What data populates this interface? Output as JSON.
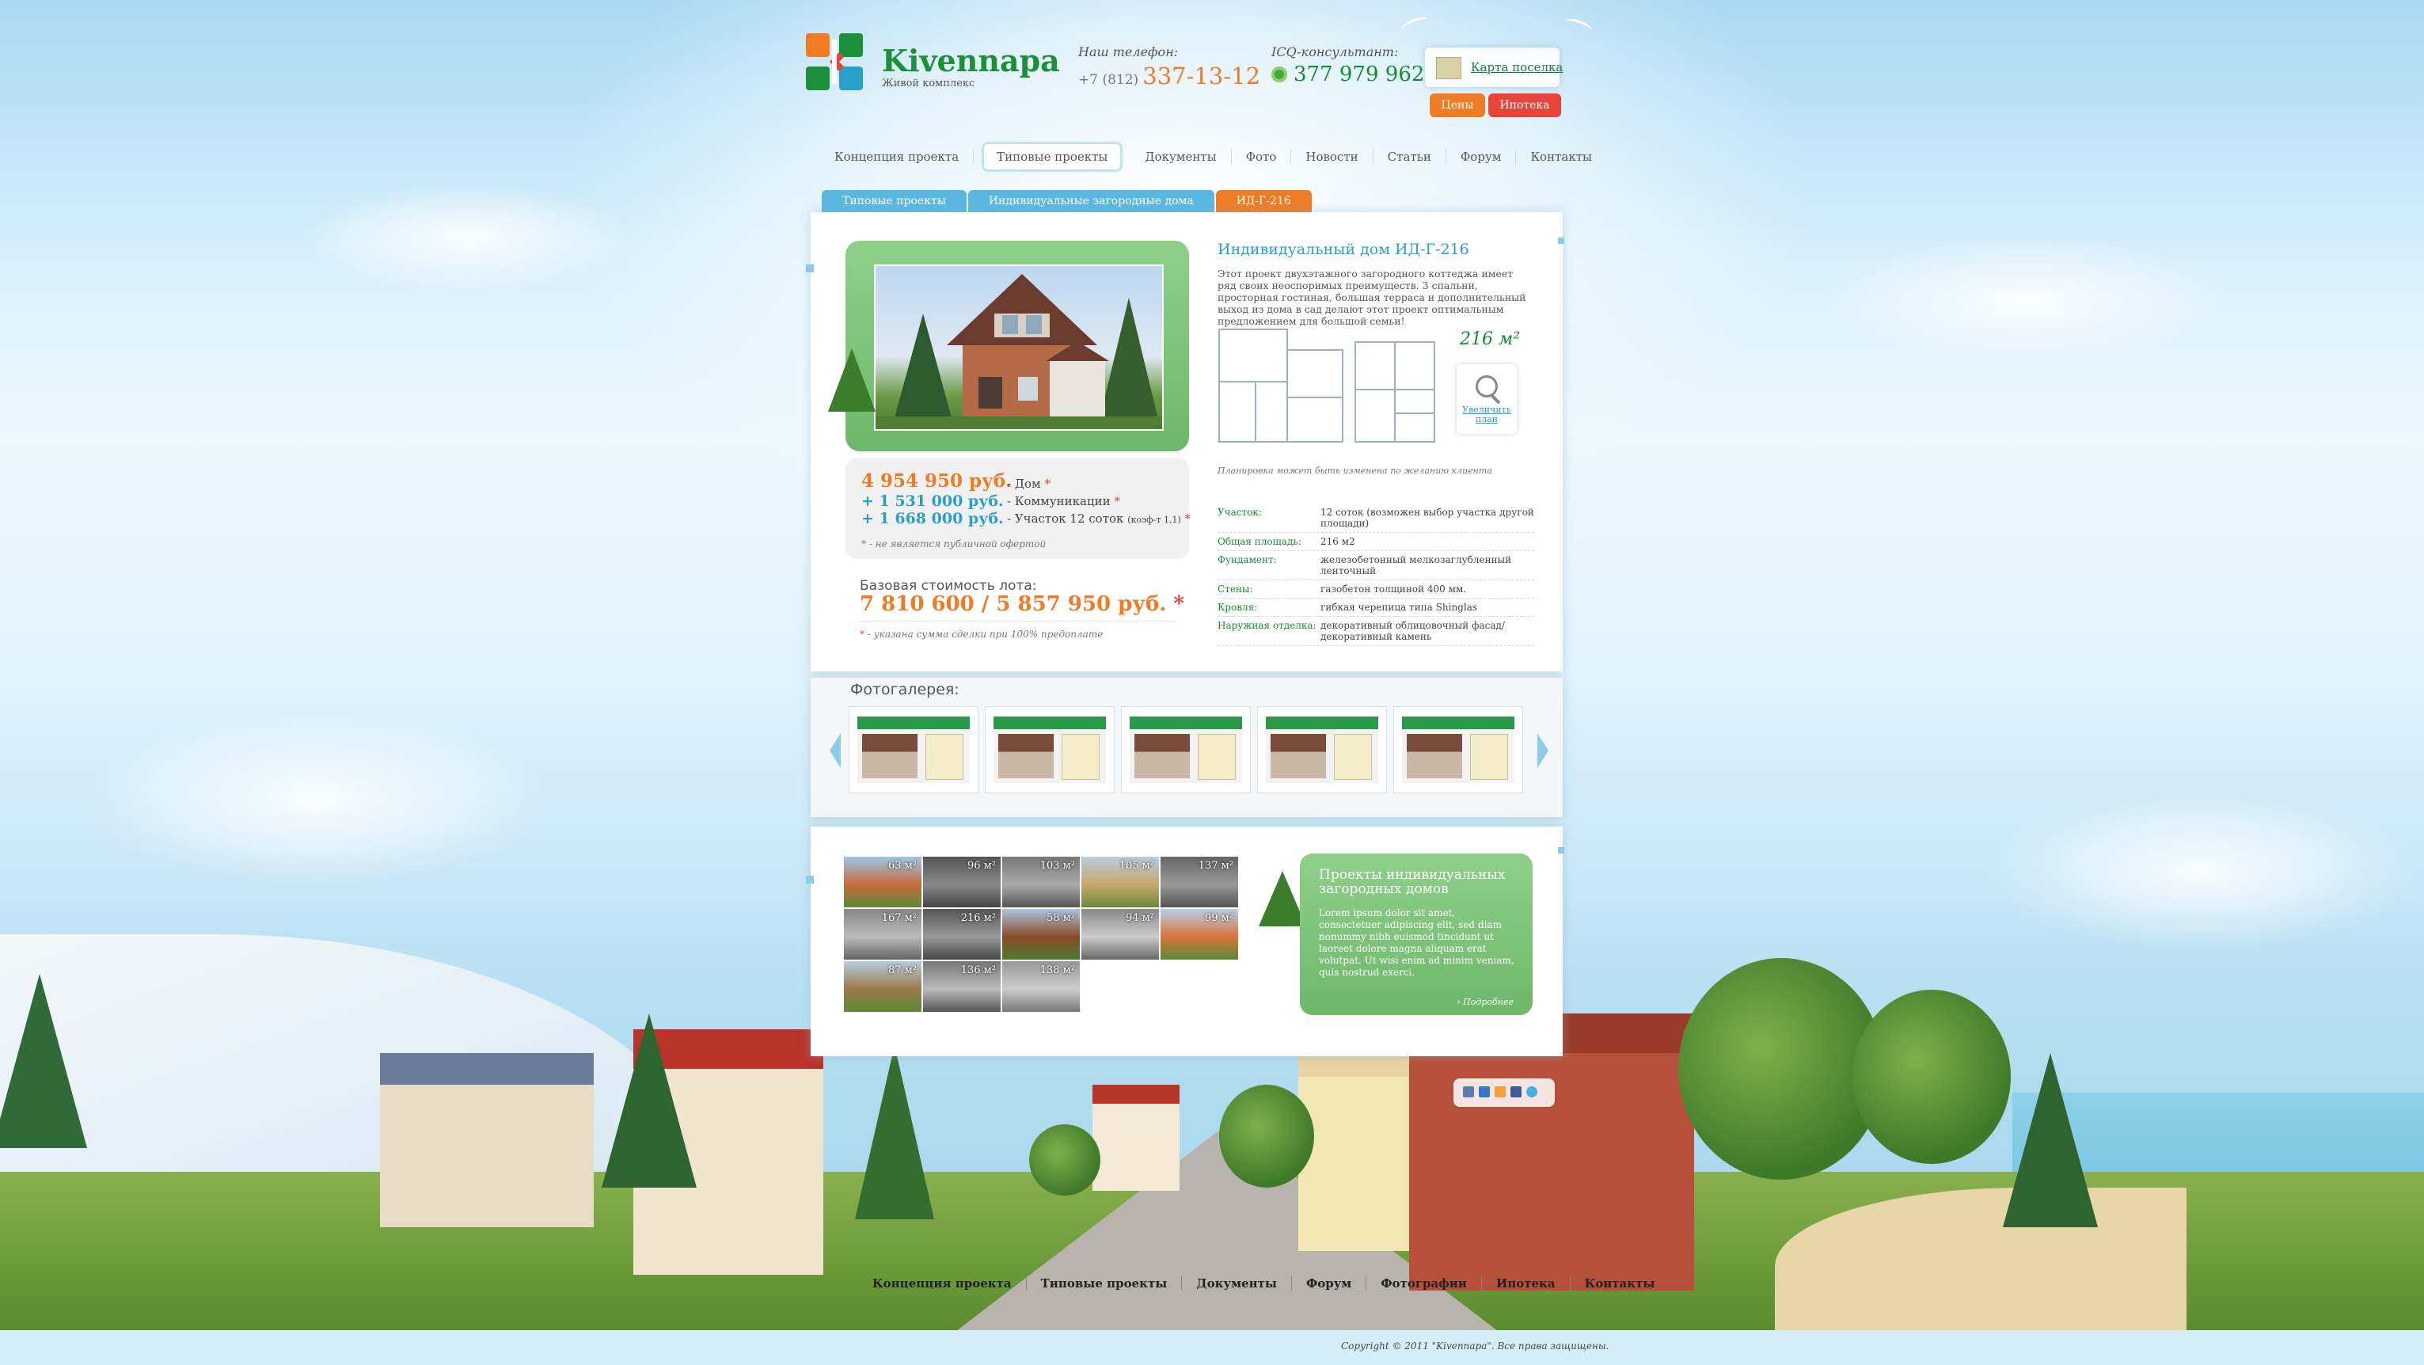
{
  "brand": {
    "name": "Kivennapa",
    "tagline": "Живой комплекс"
  },
  "header": {
    "phone_label": "Наш телефон:",
    "phone_code": "+7 (812)",
    "phone_number": "337-13-12",
    "icq_label": "ICQ-консультант:",
    "icq_number": "377 979 962",
    "map_link": "Карта поселка",
    "prices_button": "Цены",
    "mortgage_button": "Ипотека"
  },
  "nav": {
    "items": [
      "Концепция проекта",
      "Типовые проекты",
      "Документы",
      "Фото",
      "Новости",
      "Статьи",
      "Форум",
      "Контакты"
    ],
    "active_index": 1
  },
  "subtabs": [
    "Типовые проекты",
    "Индивидуальные загородные дома",
    "ИД-Г-216"
  ],
  "house": {
    "title": "Индивидуальный дом ИД-Г-216",
    "description": "Этот проект двухэтажного загородного коттеджа имеет ряд своих неоспоримых преимуществ. 3 спальни, просторная гостиная, большая терраса и дополнительный выход из дома в сад делают этот проект оптимальным предложением для большой семьи!",
    "area": "216 м²",
    "zoom_label": "Увеличить план",
    "plan_note": "Планировка может быть изменена по желанию клиента"
  },
  "prices": {
    "house_price": "4 954 950 руб.",
    "house_label": "- Дом",
    "comm_price": "+ 1 531 000 руб.",
    "comm_label": "- Коммуникации",
    "plot_price": "+ 1 668 000 руб.",
    "plot_label": "- Участок 12 соток",
    "plot_coef": "(коэф-т 1,1)",
    "offer_note": "- не является публичной офертой",
    "base_label": "Базовая стоимость лота:",
    "base_price": "7 810 600 / 5 857 950 руб.",
    "base_note": "- указана сумма сделки при 100% предоплате",
    "asterisk": "*"
  },
  "specs": [
    {
      "key": "Участок:",
      "value": "12 соток (возможен выбор участка другой площади)"
    },
    {
      "key": "Общая площадь:",
      "value": "216 м2"
    },
    {
      "key": "Фундамент:",
      "value": "железобетонный мелкозаглубленный ленточный"
    },
    {
      "key": "Стены:",
      "value": "газобетон толщиной 400 мм."
    },
    {
      "key": "Кровля:",
      "value": "гибкая черепица типа Shinglas"
    },
    {
      "key": "Наружная отделка:",
      "value": "декоративный облицовочный фасад/декоративный камень"
    }
  ],
  "gallery": {
    "title": "Фотогалерея:",
    "count": 5
  },
  "projects_grid": [
    "63 м²",
    "96 м²",
    "103 м²",
    "105 м²",
    "137 м²",
    "167 м²",
    "216 м²",
    "58 м²",
    "94 м²",
    "99 м²",
    "87 м²",
    "136 м²",
    "138 м²"
  ],
  "projects_card": {
    "title": "Проекты индивидуальных загородных домов",
    "text": "Lorem ipsum dolor sit amet, consectetuer adipiscing elit, sed diam nonummy nibh euismod tincidunt ut laoreet dolore magna aliquam erat volutpat. Ut wisi enim ad minim veniam, quis nostrud exerci.",
    "more": "Подробнее"
  },
  "footer": {
    "nav": [
      "Концепция проекта",
      "Типовые проекты",
      "Документы",
      "Форум",
      "Фотографии",
      "Ипотека",
      "Контакты"
    ],
    "copyright": "Copyright © 2011 \"Kivennapa\". Все права защищены."
  },
  "colors": {
    "accent_green": "#1b8f3a",
    "accent_orange": "#f07b25",
    "accent_blue": "#2a9fcc",
    "accent_red": "#e8443a"
  }
}
